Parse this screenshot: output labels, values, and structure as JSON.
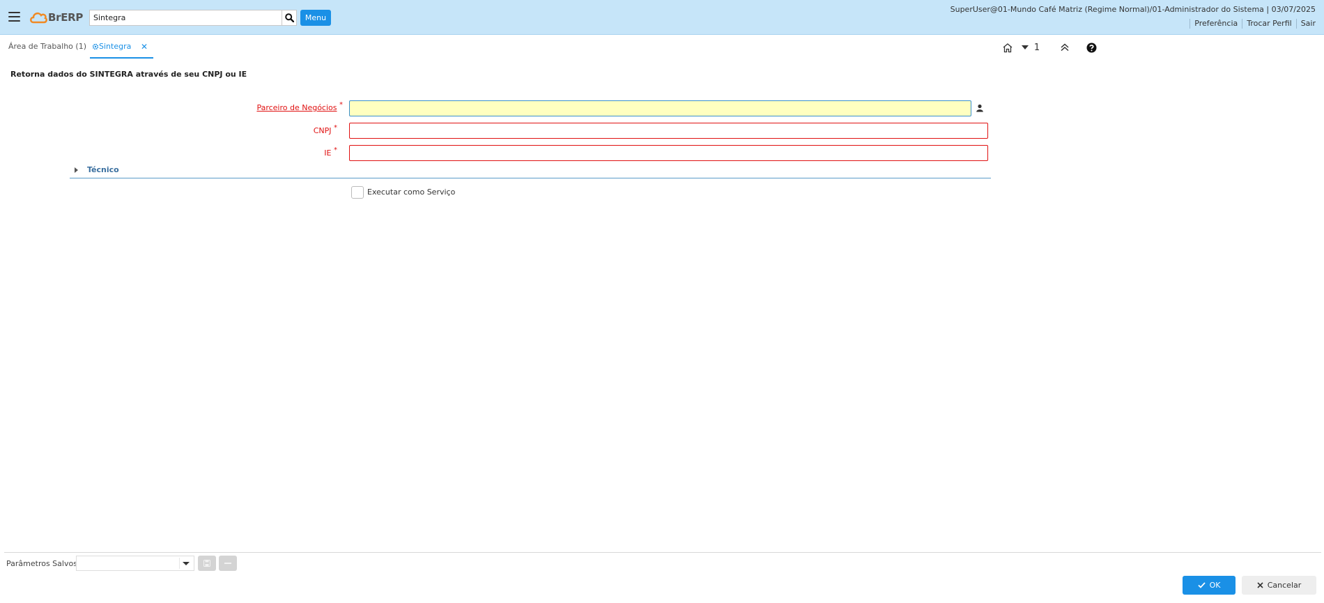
{
  "header": {
    "logo_text": "BrERP",
    "search_value": "Sintegra",
    "menu_label": "Menu",
    "user_info": "SuperUser@01-Mundo Café Matriz (Regime Normal)/01-Administrador do Sistema | 03/07/2025",
    "links": {
      "preference": "Preferência",
      "switch_profile": "Trocar Perfil",
      "logout": "Sair"
    }
  },
  "tabs": {
    "workspace": "Área de Trabalho (1)",
    "active": "Sintegra",
    "close_glyph": "✕"
  },
  "toolbar": {
    "window_count": "1"
  },
  "form": {
    "title": "Retorna dados do SINTEGRA através de seu CNPJ ou IE",
    "business_partner": {
      "label": "Parceiro de Negócios",
      "value": ""
    },
    "cnpj": {
      "label": "CNPJ",
      "value": ""
    },
    "ie": {
      "label": "IE",
      "value": ""
    },
    "required_mark": "*",
    "technical_section": "Técnico",
    "run_as_service": "Executar como Serviço"
  },
  "footer": {
    "saved_params_label": "Parâmetros Salvos",
    "saved_params_value": "",
    "ok_label": "OK",
    "cancel_label": "Cancelar"
  },
  "colors": {
    "accent": "#1a90e6",
    "header_bg": "#c6e5f9",
    "required": "#e01010",
    "focus_field_bg": "#ffffc0",
    "logo_orange": "#f08a24"
  },
  "icons": {
    "menu": "hamburger-icon",
    "search": "search-icon",
    "gear": "gear-icon",
    "home": "home-icon",
    "windows": "chevron-down-icon",
    "collapse": "double-chevron-up-icon",
    "help": "help-icon",
    "user": "user-icon",
    "save": "save-icon",
    "delete": "minus-icon",
    "ok": "check-icon",
    "cancel": "close-icon"
  }
}
